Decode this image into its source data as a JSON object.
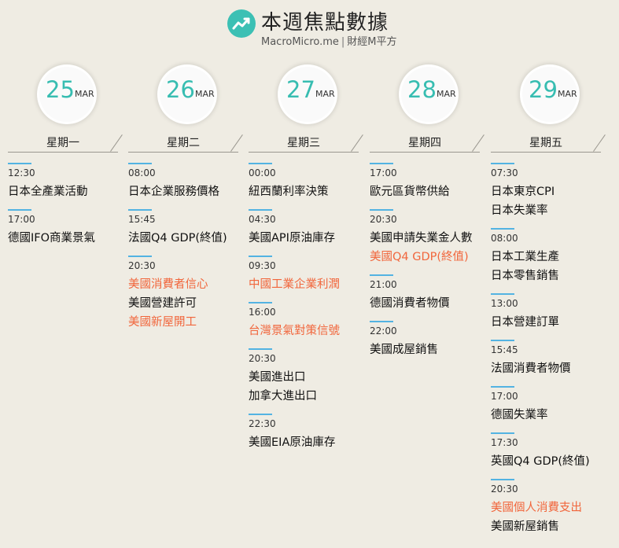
{
  "header": {
    "title": "本週焦點數據",
    "brand": "MacroMicro.me",
    "brand_cn": "財經M平方",
    "accent": "#3cc0b4",
    "highlight_color": "#f1663c"
  },
  "days": [
    {
      "day": "25",
      "month": "MAR",
      "weekday": "星期一",
      "events": [
        {
          "time": "12:30",
          "items": [
            {
              "text": "日本全產業活動",
              "hl": false
            }
          ]
        },
        {
          "time": "17:00",
          "items": [
            {
              "text": "德國IFO商業景氣",
              "hl": false
            }
          ]
        }
      ]
    },
    {
      "day": "26",
      "month": "MAR",
      "weekday": "星期二",
      "events": [
        {
          "time": "08:00",
          "items": [
            {
              "text": "日本企業服務價格",
              "hl": false
            }
          ]
        },
        {
          "time": "15:45",
          "items": [
            {
              "text": "法國Q4 GDP(終值)",
              "hl": false
            }
          ]
        },
        {
          "time": "20:30",
          "items": [
            {
              "text": "美國消費者信心",
              "hl": true
            },
            {
              "text": "美國營建許可",
              "hl": false
            },
            {
              "text": "美國新屋開工",
              "hl": true
            }
          ]
        }
      ]
    },
    {
      "day": "27",
      "month": "MAR",
      "weekday": "星期三",
      "events": [
        {
          "time": "00:00",
          "items": [
            {
              "text": "紐西蘭利率決策",
              "hl": false
            }
          ]
        },
        {
          "time": "04:30",
          "items": [
            {
              "text": "美國API原油庫存",
              "hl": false
            }
          ]
        },
        {
          "time": "09:30",
          "items": [
            {
              "text": "中國工業企業利潤",
              "hl": true
            }
          ]
        },
        {
          "time": "16:00",
          "items": [
            {
              "text": "台灣景氣對策信號",
              "hl": true
            }
          ]
        },
        {
          "time": "20:30",
          "items": [
            {
              "text": "美國進出口",
              "hl": false
            },
            {
              "text": "加拿大進出口",
              "hl": false
            }
          ]
        },
        {
          "time": "22:30",
          "items": [
            {
              "text": "美國EIA原油庫存",
              "hl": false
            }
          ]
        }
      ]
    },
    {
      "day": "28",
      "month": "MAR",
      "weekday": "星期四",
      "events": [
        {
          "time": "17:00",
          "items": [
            {
              "text": "歐元區貨幣供給",
              "hl": false
            }
          ]
        },
        {
          "time": "20:30",
          "items": [
            {
              "text": "美國申請失業金人數",
              "hl": false
            },
            {
              "text": "美國Q4 GDP(終值)",
              "hl": true
            }
          ]
        },
        {
          "time": "21:00",
          "items": [
            {
              "text": "德國消費者物價",
              "hl": false
            }
          ]
        },
        {
          "time": "22:00",
          "items": [
            {
              "text": "美國成屋銷售",
              "hl": false
            }
          ]
        }
      ]
    },
    {
      "day": "29",
      "month": "MAR",
      "weekday": "星期五",
      "events": [
        {
          "time": "07:30",
          "items": [
            {
              "text": "日本東京CPI",
              "hl": false
            },
            {
              "text": "日本失業率",
              "hl": false
            }
          ]
        },
        {
          "time": "08:00",
          "items": [
            {
              "text": "日本工業生產",
              "hl": false
            },
            {
              "text": "日本零售銷售",
              "hl": false
            }
          ]
        },
        {
          "time": "13:00",
          "items": [
            {
              "text": "日本營建訂單",
              "hl": false
            }
          ]
        },
        {
          "time": "15:45",
          "items": [
            {
              "text": "法國消費者物價",
              "hl": false
            }
          ]
        },
        {
          "time": "17:00",
          "items": [
            {
              "text": "德國失業率",
              "hl": false
            }
          ]
        },
        {
          "time": "17:30",
          "items": [
            {
              "text": "英國Q4 GDP(終值)",
              "hl": false
            }
          ]
        },
        {
          "time": "20:30",
          "items": [
            {
              "text": "美國個人消費支出",
              "hl": true
            },
            {
              "text": "美國新屋銷售",
              "hl": false
            }
          ]
        }
      ]
    }
  ]
}
